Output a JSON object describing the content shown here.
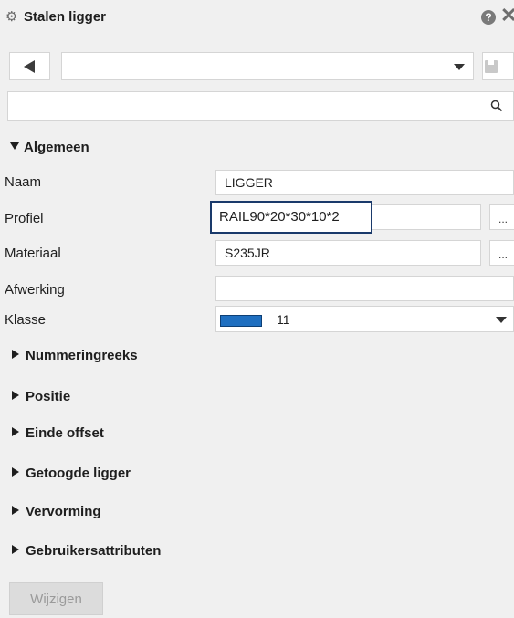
{
  "panel": {
    "title": "Stalen ligger",
    "help_icon_glyph": "?",
    "close_icon_glyph": "✕"
  },
  "toolbar": {
    "preset_value": "",
    "back_icon": "triangle-left-icon",
    "save_icon": "floppy-disk-icon"
  },
  "search": {
    "value": "",
    "icon": "magnifier-icon"
  },
  "section": {
    "label": "Algemeen"
  },
  "properties": [
    {
      "label": "Naam",
      "value": "LIGGER"
    },
    {
      "label": "Profiel",
      "value": "RAIL90*20*30*10*2"
    },
    {
      "label": "Materiaal",
      "value": "S235JR"
    },
    {
      "label": "Afwerking",
      "value": ""
    },
    {
      "label": "Klasse",
      "value": "11",
      "swatch_color": "#1f6fc0"
    }
  ],
  "ellipsis": "...",
  "groups": [
    "Nummeringreeks",
    "Positie",
    "Einde offset",
    "Getoogde ligger",
    "Vervorming",
    "Gebruikersattributen"
  ],
  "apply_button": "Wijzigen",
  "colors": {
    "background": "#f0f0f0",
    "focus_border": "#1a3a6b",
    "disabled_text": "#9a9a9a"
  }
}
